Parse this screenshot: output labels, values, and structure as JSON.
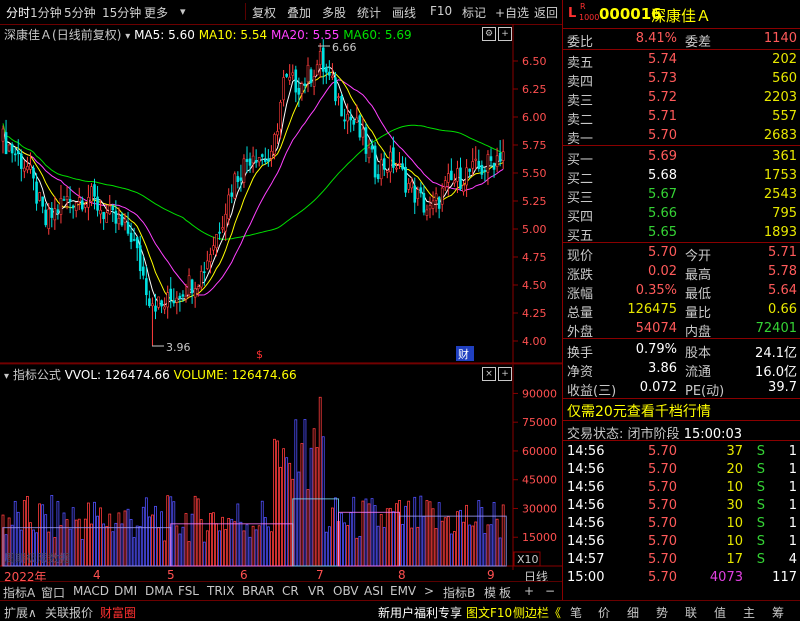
{
  "toolbar": {
    "items": [
      "分时",
      "1分钟",
      "5分钟",
      "15分钟",
      "更多",
      "复权",
      "叠加",
      "多股",
      "统计",
      "画线",
      "F10",
      "标记",
      "+自选",
      "返回"
    ]
  },
  "chart_header": {
    "name": "深康佳Ａ",
    "mode": "(日线前复权)",
    "ma5": "MA5: 5.60",
    "ma10": "MA10: 5.54",
    "ma20": "MA20: 5.55",
    "ma60": "MA60: 5.69",
    "high_note": "6.66",
    "low_note": "3.96"
  },
  "price_axis": [
    "6.50",
    "6.25",
    "6.00",
    "5.75",
    "5.50",
    "5.25",
    "5.00",
    "4.75",
    "4.50",
    "4.25",
    "4.00"
  ],
  "volume_header": {
    "label": "指标公式",
    "vol": "VVOL: 126474.66",
    "volume": "VOLUME: 126474.66"
  },
  "volume_axis": [
    "90000",
    "75000",
    "60000",
    "45000",
    "30000",
    "15000"
  ],
  "volume_unit": "X10",
  "volume_watermark": "周期极限数据",
  "event_marks": {
    "dividend": "$",
    "fin": "财"
  },
  "date_axis": {
    "year": "2022年",
    "months": [
      "4",
      "5",
      "6",
      "7",
      "8",
      "9"
    ],
    "period": "日线"
  },
  "bottom_tabs": [
    "指标A",
    "窗口",
    "MACD",
    "DMI",
    "DMA",
    "FSL",
    "TRIX",
    "BRAR",
    "CR",
    "VR",
    "OBV",
    "ASI",
    "EMV",
    ">",
    "指标B",
    "模",
    "板"
  ],
  "status_bar": {
    "left": [
      "扩展∧",
      "关联报价",
      "财富圈"
    ],
    "promo": "新用户福利专享",
    "f10": "图文F10",
    "sidebar": "侧边栏《",
    "right": [
      "笔",
      "价",
      "细",
      "势",
      "联",
      "值",
      "主",
      "筹"
    ]
  },
  "quote": {
    "code": "000016",
    "name": "深康佳Ａ",
    "badge_l": "L",
    "badge_r": "R",
    "badge_num": "1000",
    "weibi_label": "委比",
    "weibi": "8.41%",
    "weicha_label": "委差",
    "weicha": "1140",
    "asks": [
      {
        "label": "卖五",
        "price": "5.74",
        "vol": "202"
      },
      {
        "label": "卖四",
        "price": "5.73",
        "vol": "560"
      },
      {
        "label": "卖三",
        "price": "5.72",
        "vol": "2203"
      },
      {
        "label": "卖二",
        "price": "5.71",
        "vol": "557"
      },
      {
        "label": "卖一",
        "price": "5.70",
        "vol": "2683"
      }
    ],
    "bids": [
      {
        "label": "买一",
        "price": "5.69",
        "vol": "361"
      },
      {
        "label": "买二",
        "price": "5.68",
        "vol": "1753"
      },
      {
        "label": "买三",
        "price": "5.67",
        "vol": "2543"
      },
      {
        "label": "买四",
        "price": "5.66",
        "vol": "795"
      },
      {
        "label": "买五",
        "price": "5.65",
        "vol": "1893"
      }
    ],
    "stats": [
      {
        "l1": "现价",
        "v1": "5.70",
        "l2": "今开",
        "v2": "5.71"
      },
      {
        "l1": "涨跌",
        "v1": "0.02",
        "l2": "最高",
        "v2": "5.78"
      },
      {
        "l1": "涨幅",
        "v1": "0.35%",
        "l2": "最低",
        "v2": "5.64"
      },
      {
        "l1": "总量",
        "v1": "126475",
        "l2": "量比",
        "v2": "0.66"
      },
      {
        "l1": "外盘",
        "v1": "54074",
        "l2": "内盘",
        "v2": "72401"
      }
    ],
    "stats2": [
      {
        "l1": "换手",
        "v1": "0.79%",
        "l2": "股本",
        "v2": "24.1亿"
      },
      {
        "l1": "净资",
        "v1": "3.86",
        "l2": "流通",
        "v2": "16.0亿"
      },
      {
        "l1": "收益(三)",
        "v1": "0.072",
        "l2": "PE(动)",
        "v2": "39.7"
      }
    ],
    "promo": "仅需20元查看千档行情",
    "trade_state_label": "交易状态:",
    "trade_state": "闭市阶段",
    "trade_time": "15:00:03",
    "ticks": [
      {
        "t": "14:56",
        "p": "5.70",
        "v": "37",
        "s": "S",
        "n": "1"
      },
      {
        "t": "14:56",
        "p": "5.70",
        "v": "20",
        "s": "S",
        "n": "1"
      },
      {
        "t": "14:56",
        "p": "5.70",
        "v": "10",
        "s": "S",
        "n": "1"
      },
      {
        "t": "14:56",
        "p": "5.70",
        "v": "30",
        "s": "S",
        "n": "1"
      },
      {
        "t": "14:56",
        "p": "5.70",
        "v": "10",
        "s": "S",
        "n": "1"
      },
      {
        "t": "14:56",
        "p": "5.70",
        "v": "10",
        "s": "S",
        "n": "1"
      },
      {
        "t": "14:57",
        "p": "5.70",
        "v": "17",
        "s": "S",
        "n": "4"
      },
      {
        "t": "15:00",
        "p": "5.70",
        "v": "4073",
        "s": "",
        "n": "117"
      }
    ]
  },
  "colors": {
    "up": "#ff3c3c",
    "down": "#00e0e0",
    "ma5": "#ffffff",
    "ma10": "#ffff00",
    "ma20": "#ff40ff",
    "ma60": "#00e000",
    "axis": "#8a0000"
  }
}
